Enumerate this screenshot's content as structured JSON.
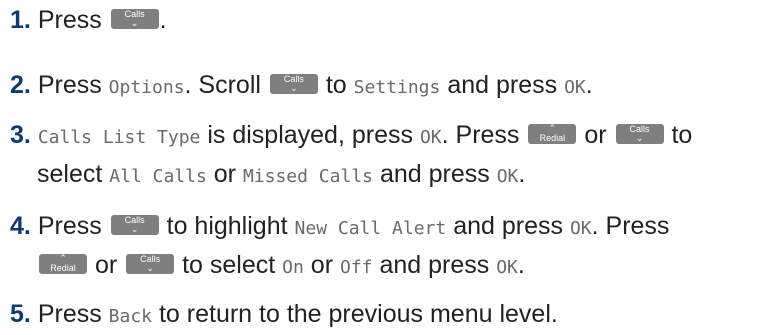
{
  "steps": [
    {
      "num": "1",
      "dot": ".",
      "t1": "Press",
      "t2": "."
    },
    {
      "num": "2",
      "dot": ".",
      "t1": "Press",
      "options": "Options",
      "t2": ". Scroll",
      "t3": "to",
      "settings": "Settings",
      "t4": "and press",
      "ok": "OK",
      "t5": "."
    },
    {
      "num": "3",
      "dot": ".",
      "callslisttype": "Calls List Type",
      "t1": "is displayed, press",
      "ok1": "OK",
      "t2": ". Press",
      "t3": "or",
      "t4": "to",
      "t5": "select",
      "allcalls": "All Calls",
      "t6": "or",
      "missedcalls": "Missed Calls",
      "t7": "and press",
      "ok2": "OK",
      "t8": "."
    },
    {
      "num": "4",
      "dot": ".",
      "t1": "Press",
      "t2": "to highlight",
      "newcallalert": "New Call Alert",
      "t3": "and press",
      "ok1": "OK",
      "t4": ". Press",
      "t5": "or",
      "t6": "to select",
      "on": "On",
      "t7": "or",
      "off": "Off",
      "t8": "and press",
      "ok2": "OK",
      "t9": "."
    },
    {
      "num": "5",
      "dot": ".",
      "t1": "Press",
      "back": "Back",
      "t2": "to return to the previous menu level."
    }
  ],
  "keys": {
    "calls": {
      "label": "Calls",
      "arrow": "⌄",
      "icon": "chevron-down-icon"
    },
    "redial": {
      "label": "Redial",
      "arrow": "⌃",
      "icon": "chevron-up-icon"
    }
  },
  "colors": {
    "step_number": "#0b3a75",
    "key_bg": "#7f7f7f",
    "lcd_text": "#6a6a6a"
  }
}
